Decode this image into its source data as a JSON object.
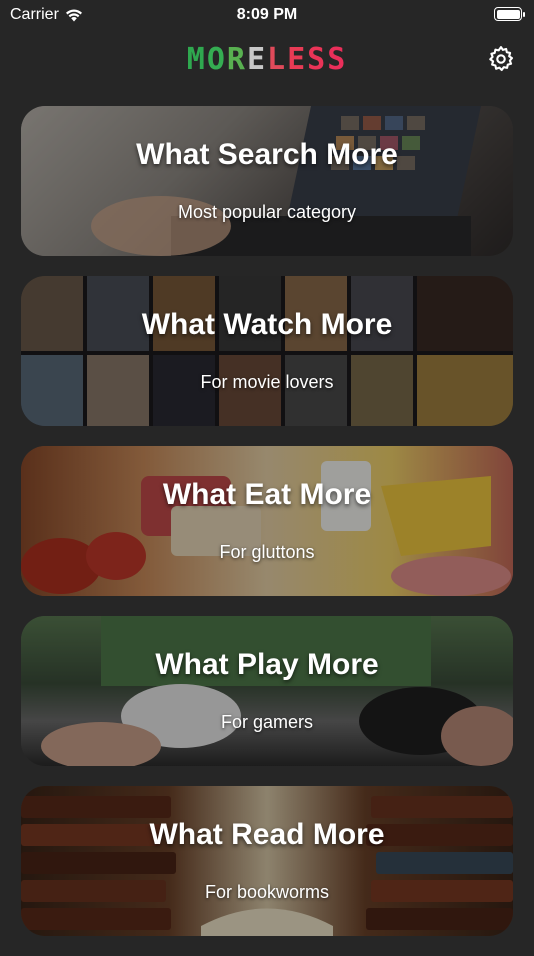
{
  "status_bar": {
    "carrier": "Carrier",
    "time": "8:09 PM",
    "wifi_icon": "wifi-icon",
    "battery_icon": "battery-icon"
  },
  "header": {
    "logo_letters": [
      "M",
      "O",
      "R",
      "E",
      "L",
      "E",
      "S",
      "S"
    ],
    "logo_colors": [
      "#2fa84f",
      "#35ad52",
      "#58b050",
      "#c8c8c8",
      "#e04a5a",
      "#e83b55",
      "#ea3457",
      "#ea2f5a"
    ],
    "settings_icon": "gear-icon"
  },
  "cards": [
    {
      "title": "What Search More",
      "subtitle": "Most popular category"
    },
    {
      "title": "What Watch More",
      "subtitle": "For movie lovers"
    },
    {
      "title": "What Eat More",
      "subtitle": "For gluttons"
    },
    {
      "title": "What Play More",
      "subtitle": "For gamers"
    },
    {
      "title": "What Read More",
      "subtitle": "For bookworms"
    }
  ]
}
